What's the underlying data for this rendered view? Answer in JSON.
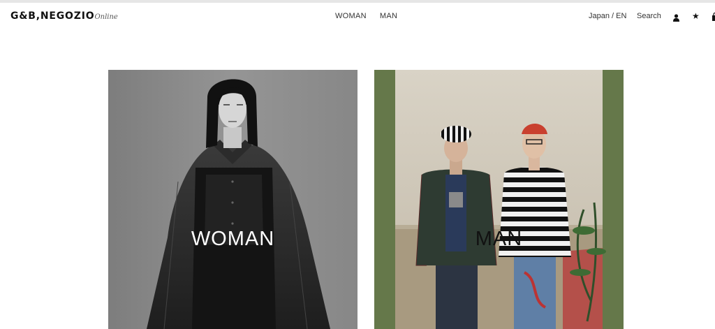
{
  "header": {
    "logo_main": "G&B,NEGOZIO",
    "logo_script": "Online",
    "nav": [
      "WOMAN",
      "MAN"
    ],
    "language": "Japan / EN",
    "search_label": "Search",
    "icons": [
      "user-icon",
      "star-icon",
      "bag-icon"
    ]
  },
  "panels": {
    "woman": {
      "label": "WOMAN"
    },
    "man": {
      "label": "MAN"
    }
  },
  "colors": {
    "woman_bg": "#8a8a8a",
    "man_bg": "#65784a"
  }
}
